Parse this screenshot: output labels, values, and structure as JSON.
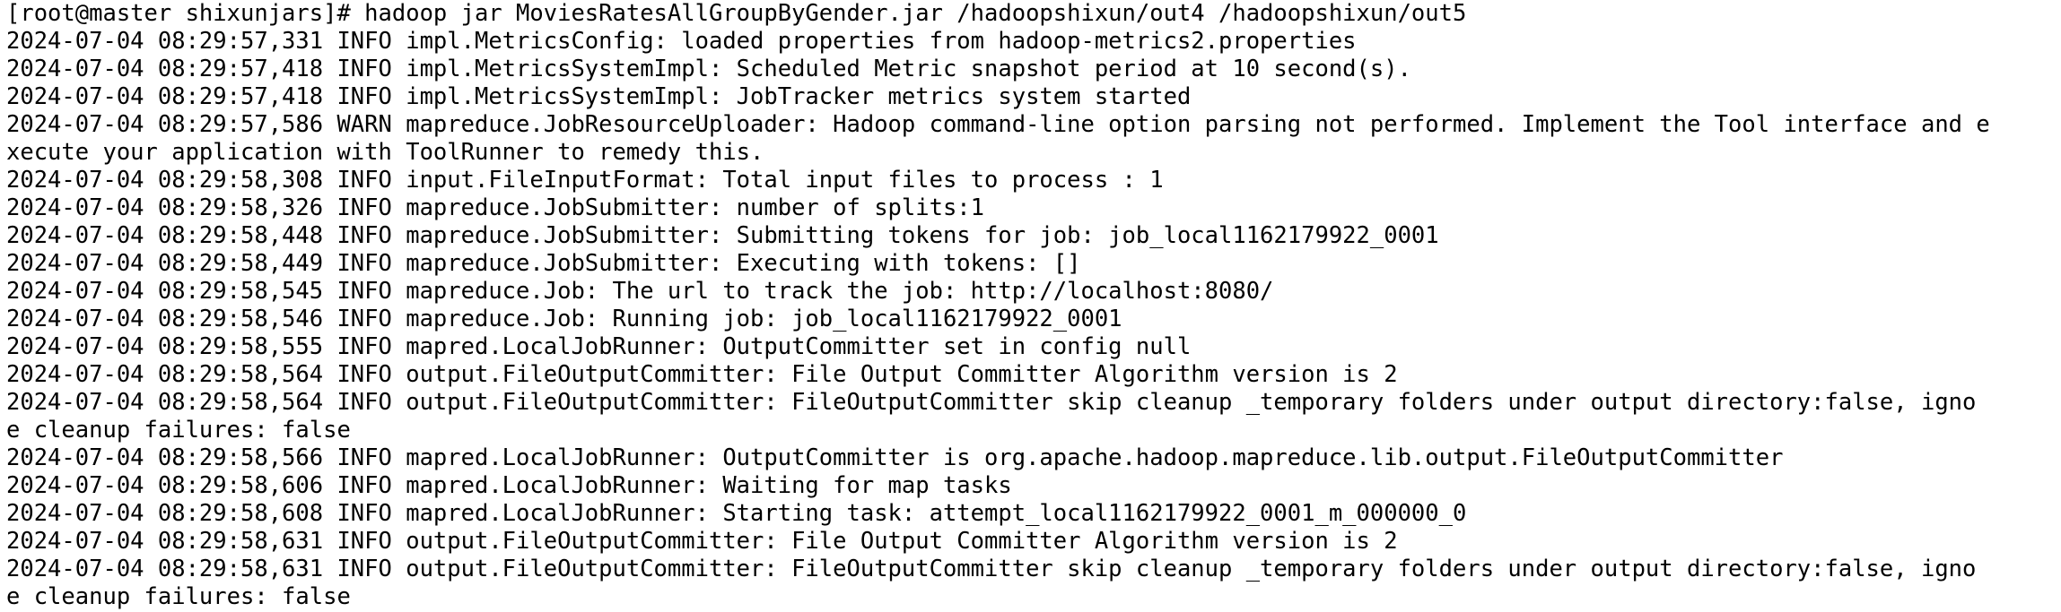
{
  "terminal": {
    "lines": [
      "[root@master shixunjars]# hadoop jar MoviesRatesAllGroupByGender.jar /hadoopshixun/out4 /hadoopshixun/out5",
      "2024-07-04 08:29:57,331 INFO impl.MetricsConfig: loaded properties from hadoop-metrics2.properties",
      "2024-07-04 08:29:57,418 INFO impl.MetricsSystemImpl: Scheduled Metric snapshot period at 10 second(s).",
      "2024-07-04 08:29:57,418 INFO impl.MetricsSystemImpl: JobTracker metrics system started",
      "2024-07-04 08:29:57,586 WARN mapreduce.JobResourceUploader: Hadoop command-line option parsing not performed. Implement the Tool interface and e",
      "xecute your application with ToolRunner to remedy this.",
      "2024-07-04 08:29:58,308 INFO input.FileInputFormat: Total input files to process : 1",
      "2024-07-04 08:29:58,326 INFO mapreduce.JobSubmitter: number of splits:1",
      "2024-07-04 08:29:58,448 INFO mapreduce.JobSubmitter: Submitting tokens for job: job_local1162179922_0001",
      "2024-07-04 08:29:58,449 INFO mapreduce.JobSubmitter: Executing with tokens: []",
      "2024-07-04 08:29:58,545 INFO mapreduce.Job: The url to track the job: http://localhost:8080/",
      "2024-07-04 08:29:58,546 INFO mapreduce.Job: Running job: job_local1162179922_0001",
      "2024-07-04 08:29:58,555 INFO mapred.LocalJobRunner: OutputCommitter set in config null",
      "2024-07-04 08:29:58,564 INFO output.FileOutputCommitter: File Output Committer Algorithm version is 2",
      "2024-07-04 08:29:58,564 INFO output.FileOutputCommitter: FileOutputCommitter skip cleanup _temporary folders under output directory:false, igno",
      "e cleanup failures: false",
      "2024-07-04 08:29:58,566 INFO mapred.LocalJobRunner: OutputCommitter is org.apache.hadoop.mapreduce.lib.output.FileOutputCommitter",
      "2024-07-04 08:29:58,606 INFO mapred.LocalJobRunner: Waiting for map tasks",
      "2024-07-04 08:29:58,608 INFO mapred.LocalJobRunner: Starting task: attempt_local1162179922_0001_m_000000_0",
      "2024-07-04 08:29:58,631 INFO output.FileOutputCommitter: File Output Committer Algorithm version is 2",
      "2024-07-04 08:29:58,631 INFO output.FileOutputCommitter: FileOutputCommitter skip cleanup _temporary folders under output directory:false, igno",
      "e cleanup failures: false"
    ]
  }
}
